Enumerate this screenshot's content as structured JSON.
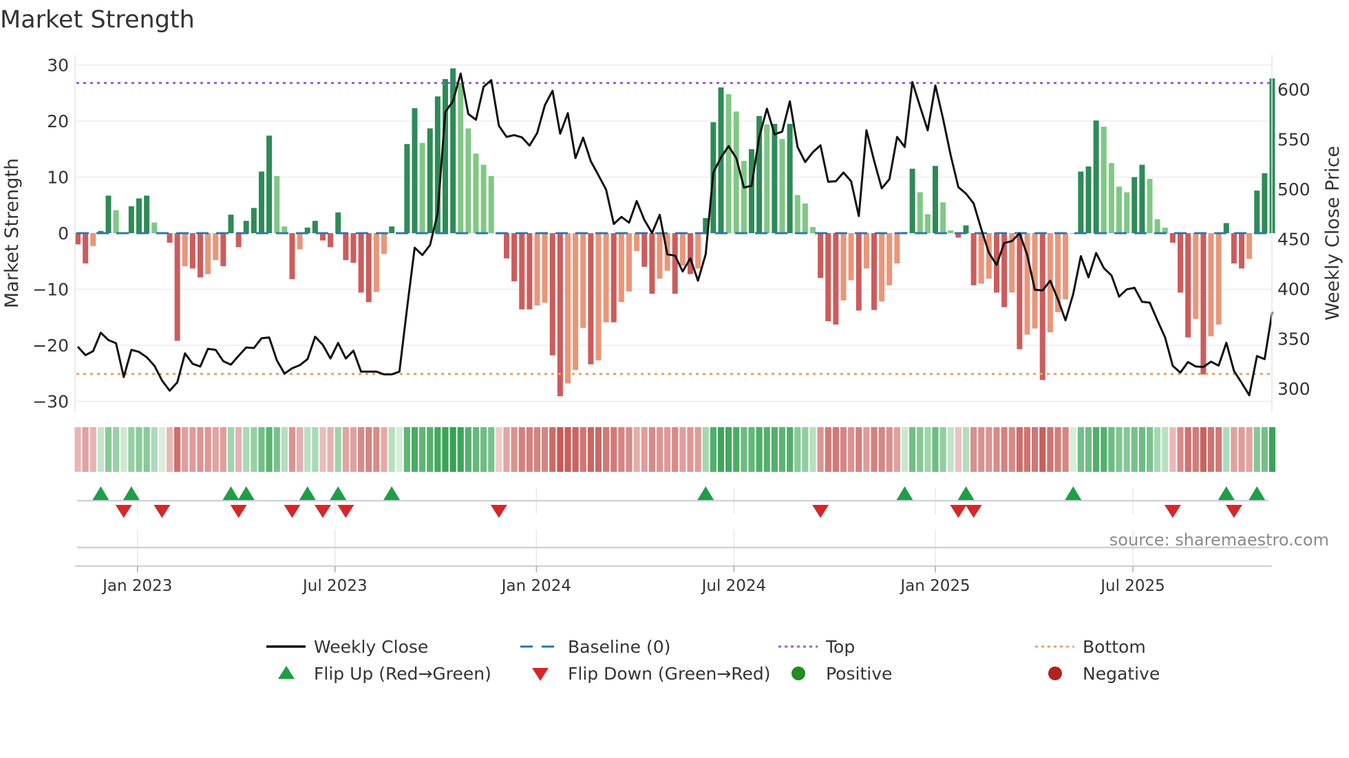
{
  "chart_data": {
    "type": "bar",
    "title": "Market Strength",
    "ylabel": "Market Strength",
    "y2label": "Weekly Close Price",
    "ylim": [
      -32,
      32
    ],
    "y2lim": [
      270,
      640
    ],
    "yticks": [
      "30",
      "20",
      "10",
      "0",
      "−10",
      "−20",
      "−30"
    ],
    "ytick_values": [
      30,
      20,
      10,
      0,
      -10,
      -20,
      -30
    ],
    "y2ticks": [
      "600",
      "550",
      "500",
      "450",
      "400",
      "350",
      "300"
    ],
    "y2tick_values": [
      600,
      550,
      500,
      450,
      400,
      350,
      300
    ],
    "xticks": [
      {
        "label": "Jan 2023",
        "week": 7.8
      },
      {
        "label": "Jul 2023",
        "week": 33.6
      },
      {
        "label": "Jan 2024",
        "week": 59.9
      },
      {
        "label": "Jul 2024",
        "week": 85.7
      },
      {
        "label": "Jan 2025",
        "week": 112.0
      },
      {
        "label": "Jul 2025",
        "week": 137.8
      }
    ],
    "top_level": 26.8,
    "bottom_level": -25.1,
    "baseline": 0,
    "strength": [
      -2,
      -5.4,
      -2.3,
      0.4,
      6.7,
      4.1,
      0.1,
      4.8,
      6.2,
      6.7,
      1.9,
      0,
      -1.7,
      -19.2,
      -5.9,
      -6.3,
      -7.9,
      -7.3,
      -4.8,
      -5.9,
      3.3,
      -2.5,
      2.2,
      4.5,
      11,
      17.4,
      10.2,
      1.2,
      -8.2,
      -2.9,
      1.0,
      2.2,
      -1.3,
      -2.5,
      3.7,
      -4.8,
      -5.3,
      -10.6,
      -12.3,
      -10.5,
      -3.7,
      1.2,
      0,
      15.9,
      22.3,
      16.1,
      18.7,
      24.4,
      27.5,
      29.4,
      26.8,
      18.7,
      14.2,
      12.2,
      10.2,
      -0.2,
      -4.5,
      -8.6,
      -13.6,
      -13.6,
      -12.9,
      -12.4,
      -21.8,
      -29.1,
      -26.8,
      -24.4,
      -16.9,
      -23.4,
      -22.7,
      -15.9,
      -15.9,
      -12.3,
      -10.4,
      -3.2,
      -6,
      -10.8,
      -8.1,
      -6.7,
      -10.8,
      -5.8,
      -7.3,
      -6.3,
      2.7,
      19.8,
      26,
      24.8,
      21.7,
      12.9,
      15,
      20.9,
      19.4,
      19.5,
      16.8,
      19.5,
      6.8,
      5.3,
      1.1,
      -8,
      -15.7,
      -16.3,
      -12,
      -8.4,
      -13.8,
      -6.3,
      -13.7,
      -12.2,
      -9.3,
      -5.4,
      0.2,
      11.5,
      7.3,
      3.4,
      12,
      5.5,
      0.5,
      -0.8,
      1.4,
      -9.3,
      -9,
      -8.1,
      -10.6,
      -13.2,
      -10.6,
      -20.7,
      -18.1,
      -17,
      -26.2,
      -17.7,
      -14.1,
      -11.8,
      0,
      11,
      11.9,
      20.1,
      19,
      12.5,
      8.3,
      7.3,
      10,
      12.2,
      9.7,
      2.5,
      1,
      -1.7,
      -10.6,
      -18.6,
      -15.3,
      -25.2,
      -18.4,
      -16.3,
      1.8,
      -5.4,
      -6.3,
      -4.6,
      7.6,
      10.7,
      27.6
    ],
    "close": [
      342.1,
      333.6,
      337.6,
      356.1,
      348.7,
      345.5,
      311.6,
      338.9,
      336.8,
      331.5,
      323,
      308.2,
      297.9,
      306.3,
      335.4,
      324.9,
      322.2,
      339.9,
      338.9,
      327.5,
      324.1,
      332.8,
      341.3,
      340.7,
      350.5,
      351.3,
      328.3,
      315.1,
      320.4,
      323.5,
      329.6,
      352.1,
      343.9,
      330.2,
      345.8,
      330.2,
      338.1,
      317,
      317,
      317,
      314.3,
      314.3,
      317,
      380.4,
      441.3,
      433.9,
      443.9,
      475.7,
      577.5,
      588.1,
      615.9,
      575.4,
      569.6,
      602.6,
      609.3,
      563.5,
      552.4,
      554.2,
      551.9,
      543.7,
      556.3,
      584.1,
      598.7,
      555.6,
      576.2,
      531.2,
      551.6,
      528,
      514,
      499.5,
      465.1,
      472.2,
      466.4,
      488.1,
      469,
      456.1,
      474.3,
      434.6,
      433.3,
      417.5,
      430.7,
      408.2,
      434.7,
      516.7,
      531.7,
      543.1,
      531.2,
      501.6,
      503.4,
      552.4,
      580.7,
      555,
      557.7,
      588.1,
      542.3,
      527.2,
      537,
      543.9,
      507.4,
      507.9,
      516.7,
      507.9,
      473,
      559,
      528.6,
      500.8,
      510.1,
      552.4,
      542.3,
      607.4,
      582.8,
      559,
      604,
      570.9,
      533.9,
      502.1,
      495.5,
      485.7,
      459.8,
      436,
      424.1,
      446,
      447.9,
      455.8,
      433.9,
      399.1,
      398.4,
      408.2,
      389.7,
      368.5,
      395,
      432.8,
      411.6,
      436,
      420.9,
      413.5,
      392.3,
      399.5,
      401.1,
      387,
      386.2,
      368.5,
      351.3,
      322.8,
      316.1,
      326.7,
      322.2,
      321.7,
      327,
      323,
      346,
      317.7,
      305.8,
      293.4,
      332.7,
      329.6,
      377
    ],
    "flip_up_weeks": [
      3,
      7,
      20,
      22,
      30,
      34,
      41,
      82,
      108,
      116,
      130,
      150,
      154
    ],
    "flip_down_weeks": [
      6,
      11,
      21,
      28,
      32,
      35,
      55,
      97,
      115,
      117,
      143,
      151
    ],
    "legend": {
      "placement": "bottom",
      "items": [
        {
          "label": "Weekly Close",
          "symbol": "line",
          "color": "#111111"
        },
        {
          "label": "Baseline (0)",
          "symbol": "dash",
          "color": "#1f77b4"
        },
        {
          "label": "Top",
          "symbol": "dot",
          "color": "#9b59d6"
        },
        {
          "label": "Bottom",
          "symbol": "dot",
          "color": "#f0a060"
        },
        {
          "label": "Flip Up (Red→Green)",
          "symbol": "triangle-up",
          "color": "#1e9e48"
        },
        {
          "label": "Flip Down (Green→Red)",
          "symbol": "triangle-down",
          "color": "#d62728"
        },
        {
          "label": "Positive",
          "symbol": "circle",
          "color": "#228b22"
        },
        {
          "label": "Negative",
          "symbol": "circle",
          "color": "#b22222"
        }
      ]
    },
    "colors": {
      "pos_strong": "#2e8b57",
      "pos_weak": "#82c785",
      "neg_strong": "#cd5c5c",
      "neg_weak": "#e9967a",
      "grid": "#ececf0"
    },
    "source": "source: sharemaestro.com"
  }
}
